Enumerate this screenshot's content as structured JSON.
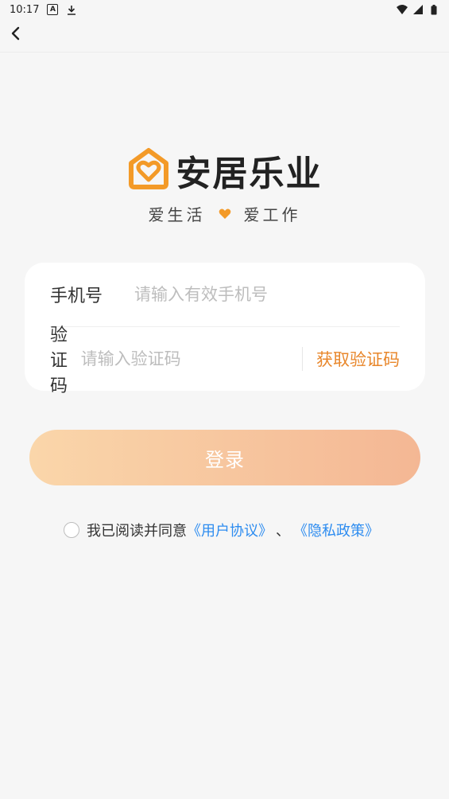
{
  "status_bar": {
    "time": "10:17",
    "icons": [
      "text-notification-icon",
      "download-icon",
      "wifi-icon",
      "signal-icon",
      "battery-icon"
    ]
  },
  "nav": {
    "back_icon": "chevron-left-icon"
  },
  "logo": {
    "name": "安居乐业",
    "slogan_left": "爱生活",
    "slogan_right": "爱工作",
    "accent_color": "#f39a28"
  },
  "form": {
    "phone_label": "手机号",
    "phone_placeholder": "请输入有效手机号",
    "phone_value": "",
    "code_label": "验证码",
    "code_placeholder": "请输入验证码",
    "code_value": "",
    "get_code_label": "获取验证码"
  },
  "login_button": {
    "label": "登录",
    "gradient_start": "#fad6aa",
    "gradient_end": "#f4b794"
  },
  "agreement": {
    "prefix": "我已阅读并同意",
    "user_agreement": "《用户协议》",
    "separator": "、",
    "privacy_policy": "《隐私政策》",
    "link_color": "#2d8cf0"
  }
}
